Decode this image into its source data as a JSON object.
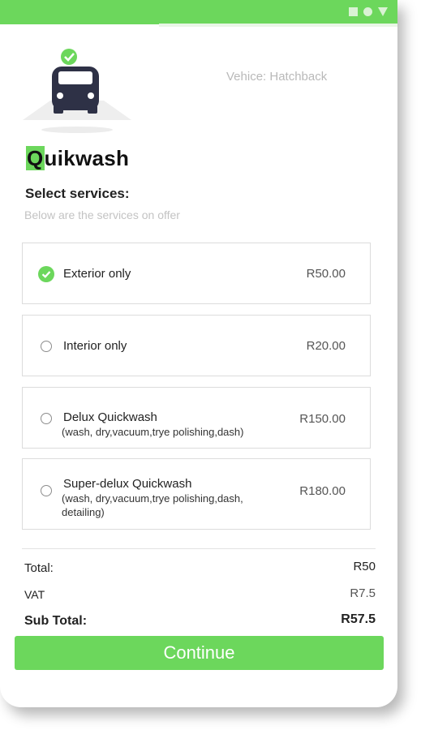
{
  "vehicle_label": "Vehice: Hatchback",
  "brand": {
    "first_letter": "Q",
    "rest": "uikwash"
  },
  "heading": "Select services:",
  "subheading": "Below are the services on offer",
  "services": [
    {
      "name": "Exterior only",
      "desc": "",
      "price": "R50.00",
      "selected": true
    },
    {
      "name": "Interior only",
      "desc": "",
      "price": "R20.00",
      "selected": false
    },
    {
      "name": "Delux Quickwash",
      "desc": "(wash, dry,vacuum,trye polishing,dash)",
      "price": "R150.00",
      "selected": false
    },
    {
      "name": "Super-delux Quickwash",
      "desc": "(wash, dry,vacuum,trye polishing,dash, detailing)",
      "price": "R180.00",
      "selected": false
    }
  ],
  "summary": {
    "total_label": "Total:",
    "total_value": "R50",
    "vat_label": "VAT",
    "vat_value": "R7.5",
    "subtotal_label": "Sub Total:",
    "subtotal_value": "R57.5"
  },
  "continue_label": "Continue",
  "colors": {
    "accent": "#6cd75c",
    "text": "#222222",
    "muted": "#b9b9b9"
  },
  "icons": {
    "status": [
      "square-icon",
      "circle-icon",
      "triangle-icon"
    ],
    "selected": "check-circle-icon",
    "unselected": "radio-empty-icon"
  }
}
